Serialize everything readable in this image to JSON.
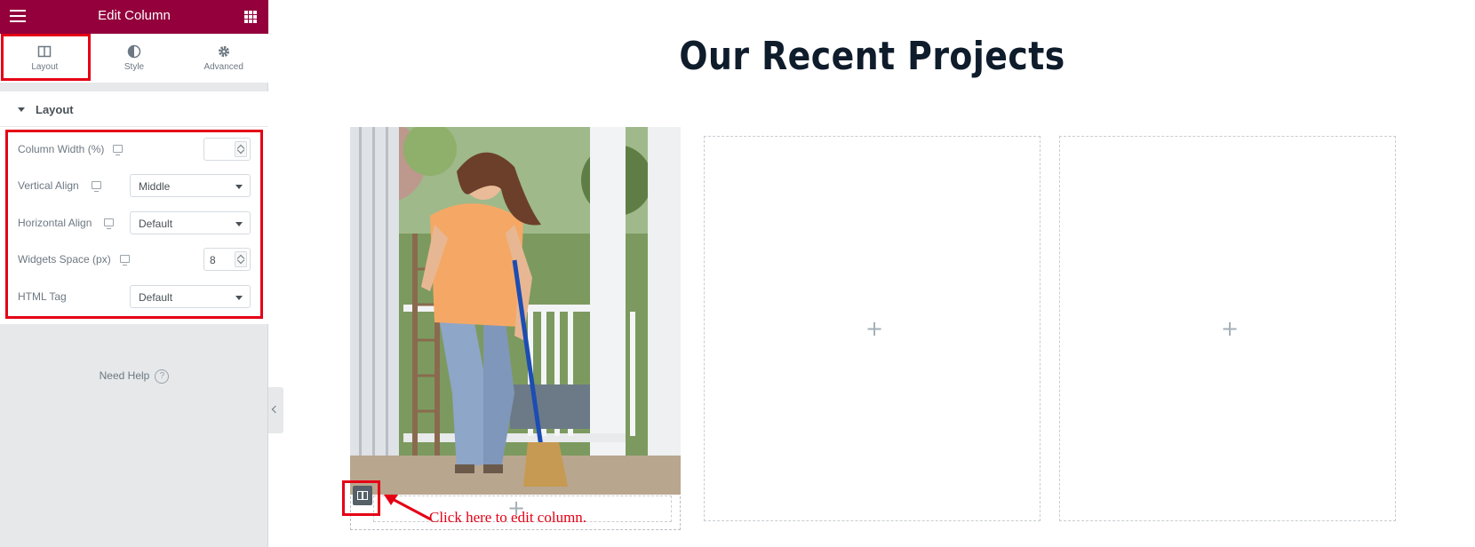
{
  "panel": {
    "header_title": "Edit Column",
    "tabs": [
      {
        "label": "Layout",
        "icon": "columns-icon",
        "active": true
      },
      {
        "label": "Style",
        "icon": "contrast-icon",
        "active": false
      },
      {
        "label": "Advanced",
        "icon": "gear-icon",
        "active": false
      }
    ],
    "section_title": "Layout",
    "controls": {
      "column_width": {
        "label": "Column Width (%)",
        "value": ""
      },
      "vertical_align": {
        "label": "Vertical Align",
        "value": "Middle"
      },
      "horizontal_align": {
        "label": "Horizontal Align",
        "value": "Default"
      },
      "widgets_space": {
        "label": "Widgets Space (px)",
        "value": "8"
      },
      "html_tag": {
        "label": "HTML Tag",
        "value": "Default"
      }
    },
    "need_help": "Need Help",
    "need_help_icon": "?"
  },
  "canvas": {
    "heading": "Our Recent Projects",
    "plus_glyph": "+",
    "annotation": "Click here to edit column."
  },
  "colors": {
    "header_bg": "#93003c",
    "highlight": "#e50015",
    "heading": "#0e1c2b"
  }
}
